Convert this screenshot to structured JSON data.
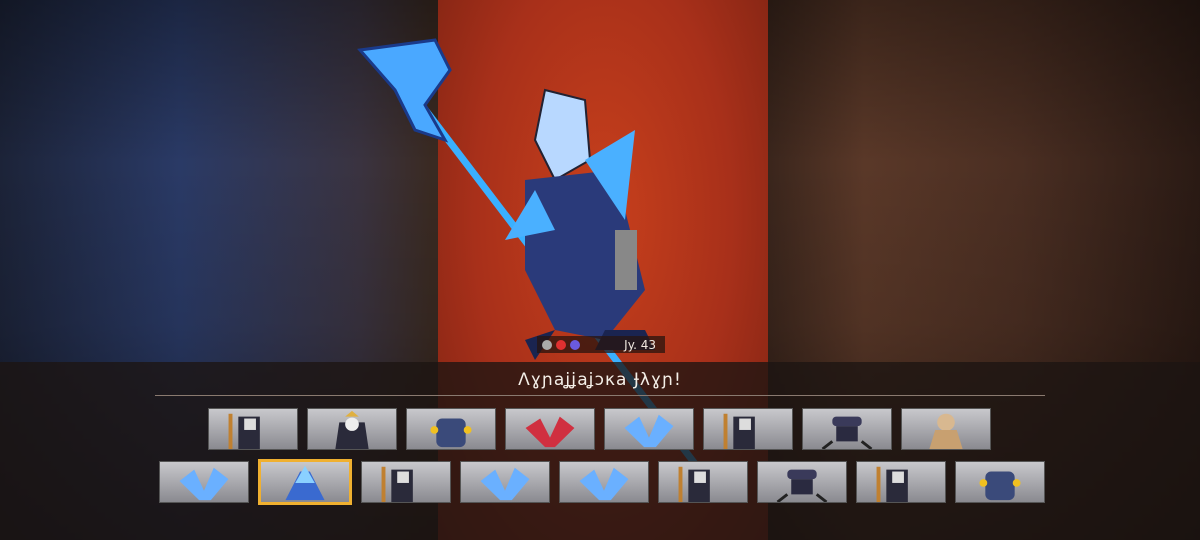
{
  "hero": {
    "name": "Λɣɲaʝʝaʝɔκa Ɉλɣɲ!",
    "level_label": "Jy. 43"
  },
  "colors": {
    "accent_selected": "#f0b030",
    "panel_red": "#b8361a"
  },
  "row1": [
    {
      "kind": "hooded-warrior"
    },
    {
      "kind": "crowned-knight"
    },
    {
      "kind": "blue-robot"
    },
    {
      "kind": "red-crystal"
    },
    {
      "kind": "blue-crystal"
    },
    {
      "kind": "hooded-warrior"
    },
    {
      "kind": "spider-mech"
    },
    {
      "kind": "bald-monk"
    }
  ],
  "row2": [
    {
      "kind": "blue-crystal"
    },
    {
      "kind": "crystal-knight",
      "selected": true
    },
    {
      "kind": "hooded-warrior"
    },
    {
      "kind": "blue-crystal"
    },
    {
      "kind": "blue-crystal"
    },
    {
      "kind": "hooded-warrior"
    },
    {
      "kind": "spider-mech"
    },
    {
      "kind": "hooded-warrior"
    },
    {
      "kind": "blue-robot"
    }
  ]
}
